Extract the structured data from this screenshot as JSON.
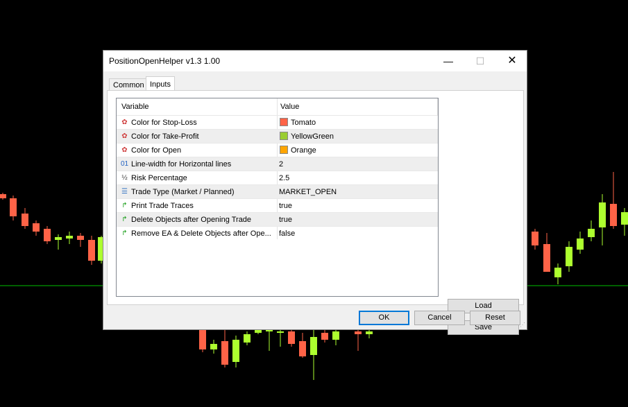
{
  "window": {
    "title": "PositionOpenHelper v1.3 1.00",
    "minimize": "—",
    "maximize": "☐",
    "close": "✕"
  },
  "tabs": [
    {
      "label": "Common"
    },
    {
      "label": "Inputs"
    }
  ],
  "grid": {
    "headers": {
      "variable": "Variable",
      "value": "Value"
    },
    "rows": [
      {
        "variable": "Color for Stop-Loss",
        "value": "Tomato",
        "icon": "color-icon",
        "swatch": "#ff6347"
      },
      {
        "variable": "Color for Take-Profit",
        "value": "YellowGreen",
        "icon": "color-icon",
        "swatch": "#9acd32"
      },
      {
        "variable": "Color for Open",
        "value": "Orange",
        "icon": "color-icon",
        "swatch": "#ffa500"
      },
      {
        "variable": "Line-width for Horizontal lines",
        "value": "2",
        "icon": "integer-icon"
      },
      {
        "variable": "Risk Percentage",
        "value": "2.5",
        "icon": "fraction-icon"
      },
      {
        "variable": "Trade Type (Market / Planned)",
        "value": "MARKET_OPEN",
        "icon": "enum-icon"
      },
      {
        "variable": "Print Trade Traces",
        "value": "true",
        "icon": "bool-icon"
      },
      {
        "variable": "Delete Objects after Opening Trade",
        "value": "true",
        "icon": "bool-icon"
      },
      {
        "variable": "Remove EA & Delete Objects after Ope...",
        "value": "false",
        "icon": "bool-icon"
      }
    ]
  },
  "buttons": {
    "load": "Load",
    "save": "Save",
    "ok": "OK",
    "cancel": "Cancel",
    "reset": "Reset"
  },
  "colors": {
    "bull": "#adff2f",
    "bear": "#ff6347",
    "hline": "#00c000",
    "chart_bg": "#000000"
  }
}
